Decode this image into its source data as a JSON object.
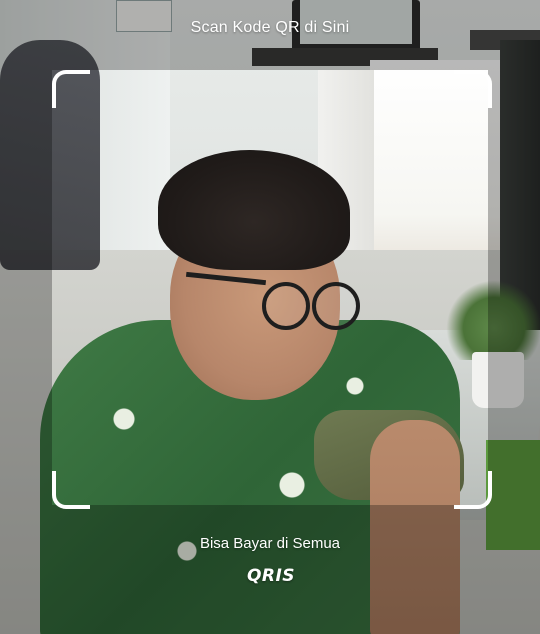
{
  "scanner": {
    "instruction": "Scan Kode QR di Sini",
    "tagline": "Bisa Bayar di Semua",
    "logo_text": "QRIS"
  },
  "icons": {
    "frame_corners": "viewfinder-corner-icon",
    "logo": "qris-logo"
  },
  "colors": {
    "frame": "#ffffff",
    "overlay": "rgba(0,0,0,0.28)"
  }
}
